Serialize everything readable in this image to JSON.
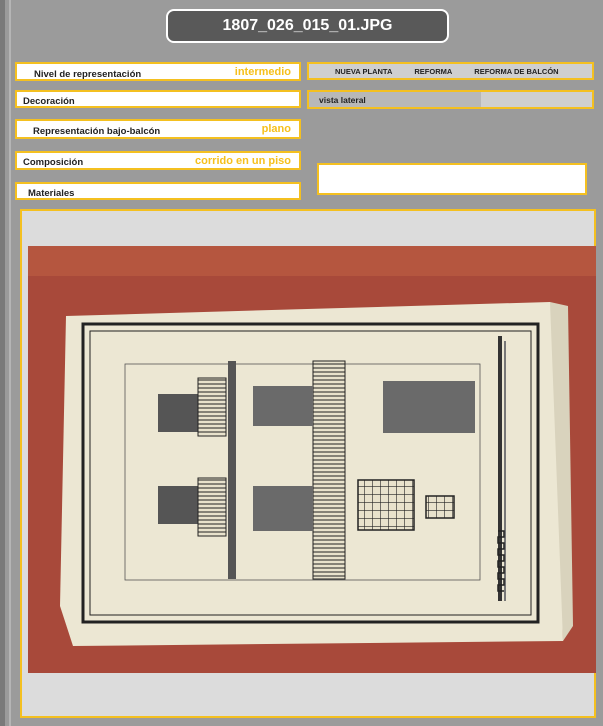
{
  "title": "1807_026_015_01.JPG",
  "fields": [
    {
      "label": "Nivel de representación",
      "value": "intermedio"
    },
    {
      "label": "Decoración",
      "value": ""
    },
    {
      "label": "Representación bajo-balcón",
      "value": "plano"
    },
    {
      "label": "Composición",
      "value": "corrido en un piso"
    },
    {
      "label": "Materiales",
      "value": ""
    }
  ],
  "tabs": [
    "NUEVA PLANTA",
    "REFORMA",
    "REFORMA DE BALCÓN"
  ],
  "view": "vista lateral",
  "notes": ""
}
